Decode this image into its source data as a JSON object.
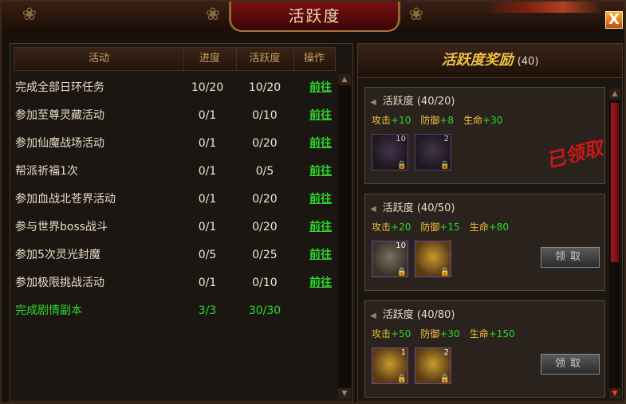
{
  "window": {
    "title": "活跃度",
    "close_icon": "close-icon",
    "close_label": "X"
  },
  "table": {
    "headers": [
      "活动",
      "进度",
      "活跃度",
      "操作"
    ],
    "rows": [
      {
        "name": "完成全部日环任务",
        "progress": "10/20",
        "activity": "10/20",
        "action": "前往",
        "done": false
      },
      {
        "name": "参加至尊灵藏活动",
        "progress": "0/1",
        "activity": "0/10",
        "action": "前往",
        "done": false
      },
      {
        "name": "参加仙魔战场活动",
        "progress": "0/1",
        "activity": "0/20",
        "action": "前往",
        "done": false
      },
      {
        "name": "帮派祈福1次",
        "progress": "0/1",
        "activity": "0/5",
        "action": "前往",
        "done": false
      },
      {
        "name": "参加血战北苍界活动",
        "progress": "0/1",
        "activity": "0/20",
        "action": "前往",
        "done": false
      },
      {
        "name": "参与世界boss战斗",
        "progress": "0/1",
        "activity": "0/20",
        "action": "前往",
        "done": false
      },
      {
        "name": "参加5次灵光封魔",
        "progress": "0/5",
        "activity": "0/25",
        "action": "前往",
        "done": false
      },
      {
        "name": "参加极限挑战活动",
        "progress": "0/1",
        "activity": "0/10",
        "action": "前往",
        "done": false
      },
      {
        "name": "完成剧情副本",
        "progress": "3/3",
        "activity": "30/30",
        "action": "",
        "done": true
      }
    ]
  },
  "rewards": {
    "title": "活跃度奖励",
    "count": "(40)",
    "cards": [
      {
        "label": "活跃度",
        "threshold": "(40/20)",
        "stats": [
          {
            "label": "攻击",
            "value": "+10"
          },
          {
            "label": "防御",
            "value": "+8"
          },
          {
            "label": "生命",
            "value": "+30"
          }
        ],
        "items": [
          {
            "count": "10",
            "icon": "crystal-icon",
            "style": "dim"
          },
          {
            "count": "2",
            "icon": "chest-icon",
            "style": "dim"
          }
        ],
        "status": "已领取",
        "button": ""
      },
      {
        "label": "活跃度",
        "threshold": "(40/50)",
        "stats": [
          {
            "label": "攻击",
            "value": "+20"
          },
          {
            "label": "防御",
            "value": "+15"
          },
          {
            "label": "生命",
            "value": "+80"
          }
        ],
        "items": [
          {
            "count": "10",
            "icon": "pet-icon",
            "style": "dark"
          },
          {
            "count": "",
            "icon": "gold-scroll-icon",
            "style": "gold"
          }
        ],
        "status": "",
        "button": "领取"
      },
      {
        "label": "活跃度",
        "threshold": "(40/80)",
        "stats": [
          {
            "label": "攻击",
            "value": "+50"
          },
          {
            "label": "防御",
            "value": "+30"
          },
          {
            "label": "生命",
            "value": "+150"
          }
        ],
        "items": [
          {
            "count": "1",
            "icon": "gold-scroll-icon",
            "style": "gold"
          },
          {
            "count": "2",
            "icon": "red-chest-icon",
            "style": "gold"
          }
        ],
        "status": "",
        "button": "领取"
      }
    ]
  }
}
